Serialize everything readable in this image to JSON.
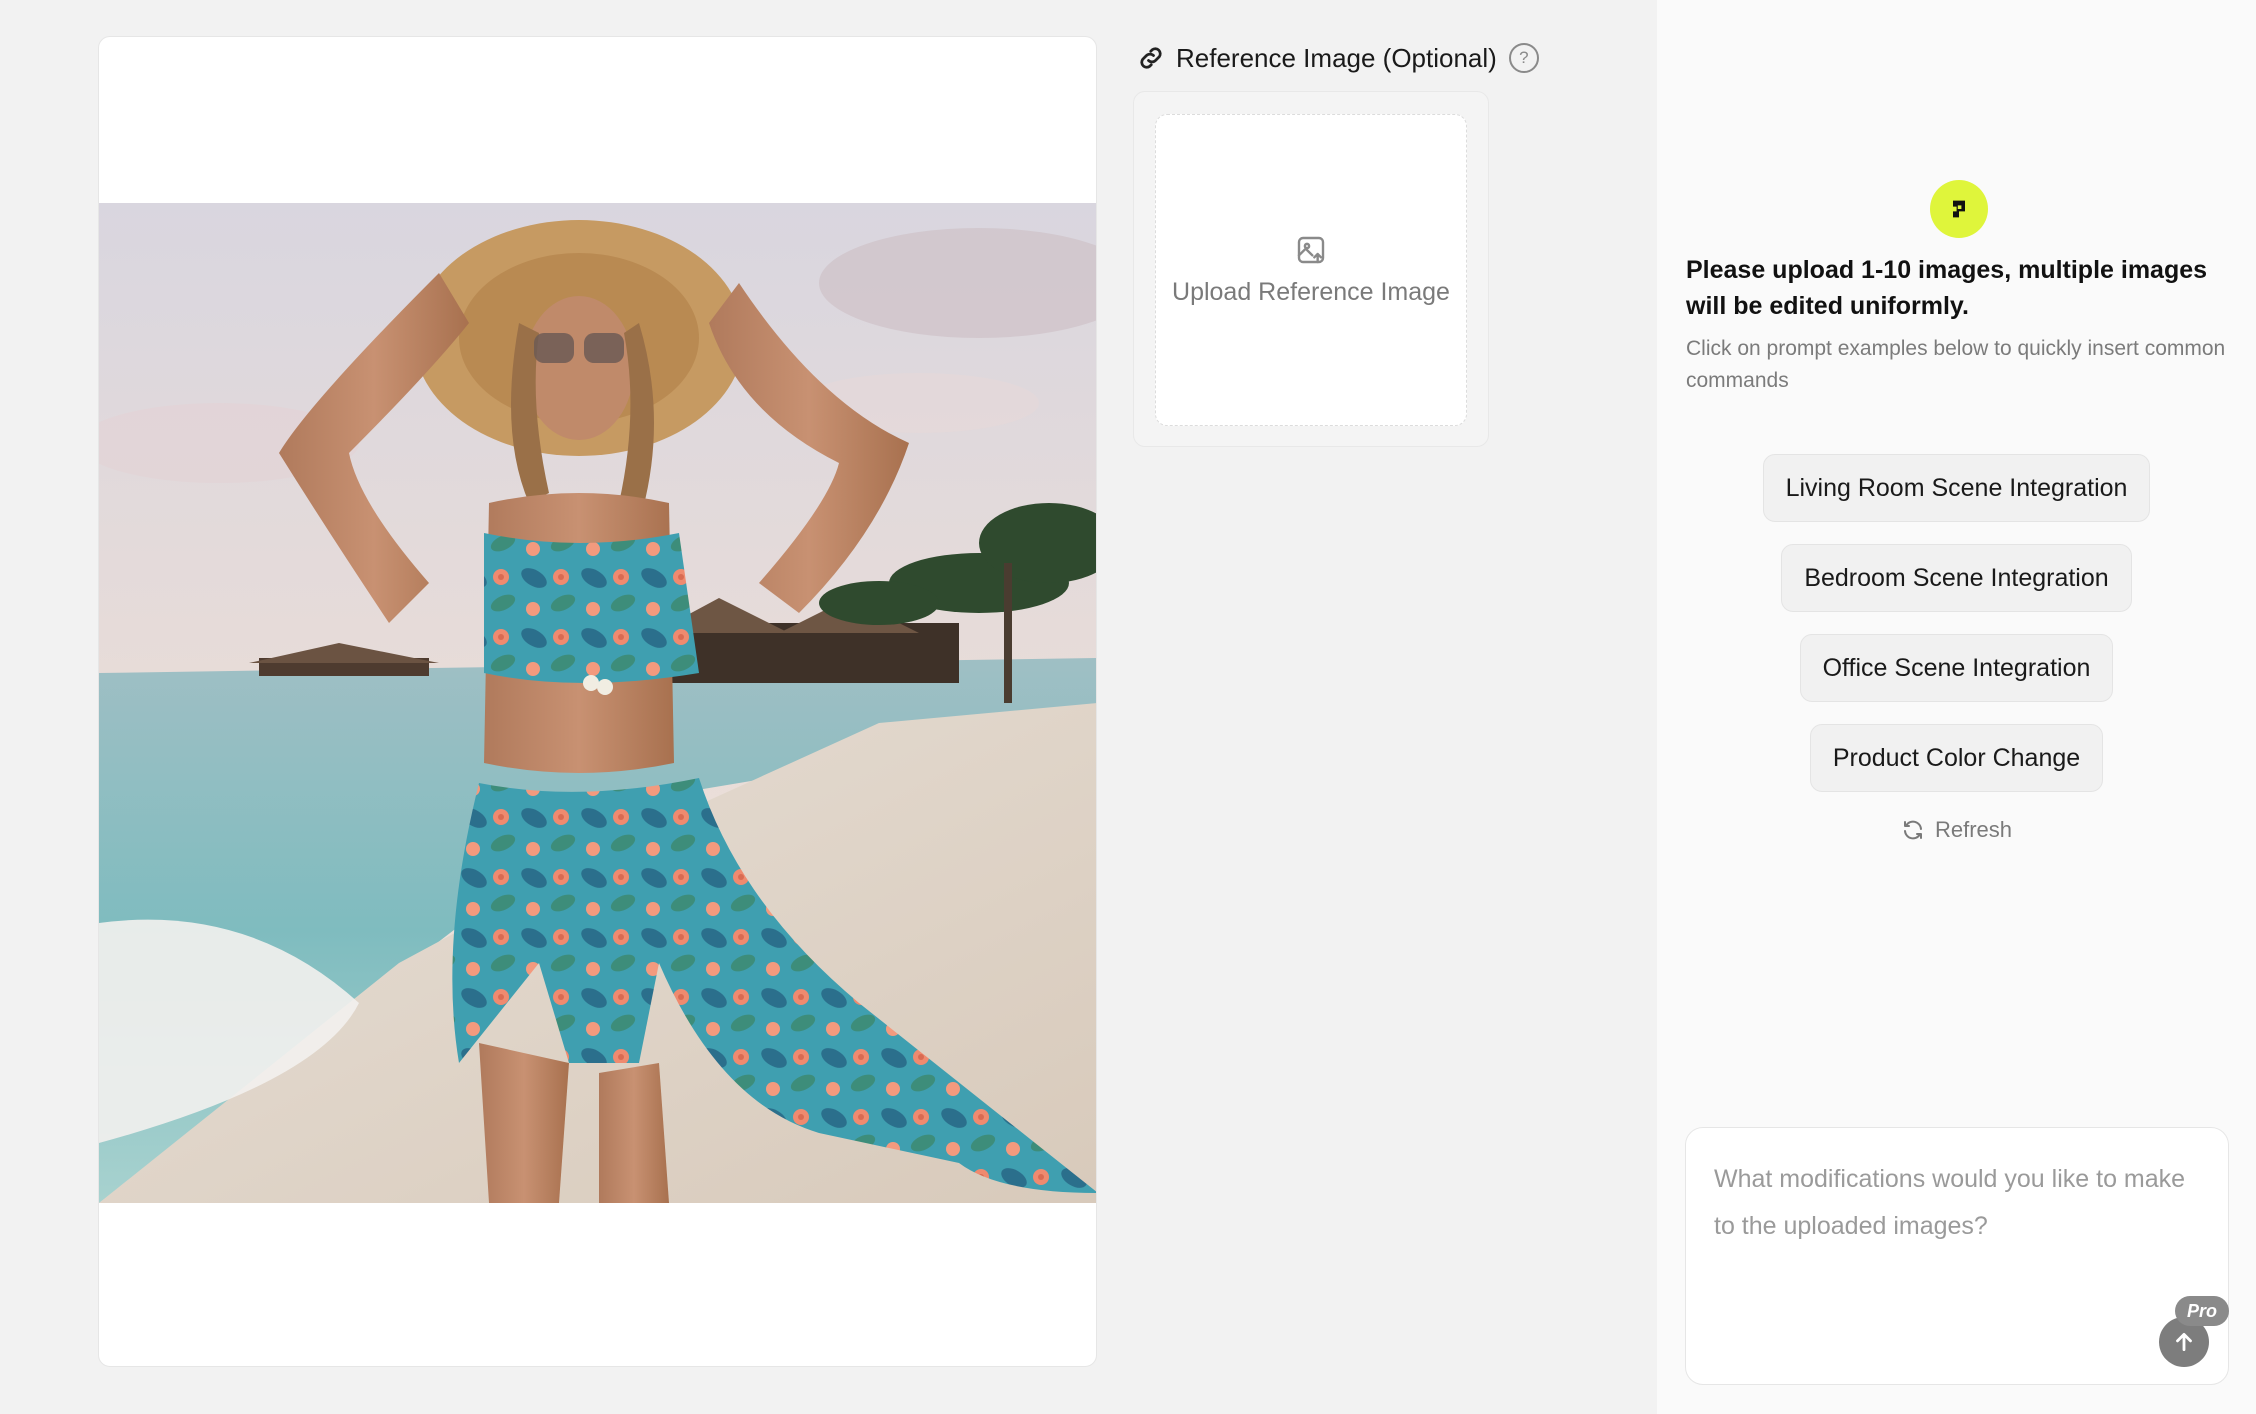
{
  "reference": {
    "title": "Reference Image (Optional)",
    "help": "?",
    "upload_label": "Upload Reference Image"
  },
  "panel": {
    "instruction": "Please upload 1-10 images, multiple images will be edited uniformly.",
    "hint": "Click on prompt examples below to quickly insert common commands",
    "prompts": [
      "Living Room Scene Integration",
      "Bedroom Scene Integration",
      "Office Scene Integration",
      "Product Color Change"
    ],
    "refresh_label": "Refresh"
  },
  "input": {
    "placeholder": "What modifications would you like to make to the uploaded images?",
    "pro_badge": "Pro"
  },
  "colors": {
    "logo_accent": "#dff53b",
    "send_button": "#7d7d7d"
  },
  "icons": [
    "link-icon",
    "help-icon",
    "image-upload-icon",
    "logo-icon",
    "refresh-icon",
    "arrow-up-icon"
  ]
}
